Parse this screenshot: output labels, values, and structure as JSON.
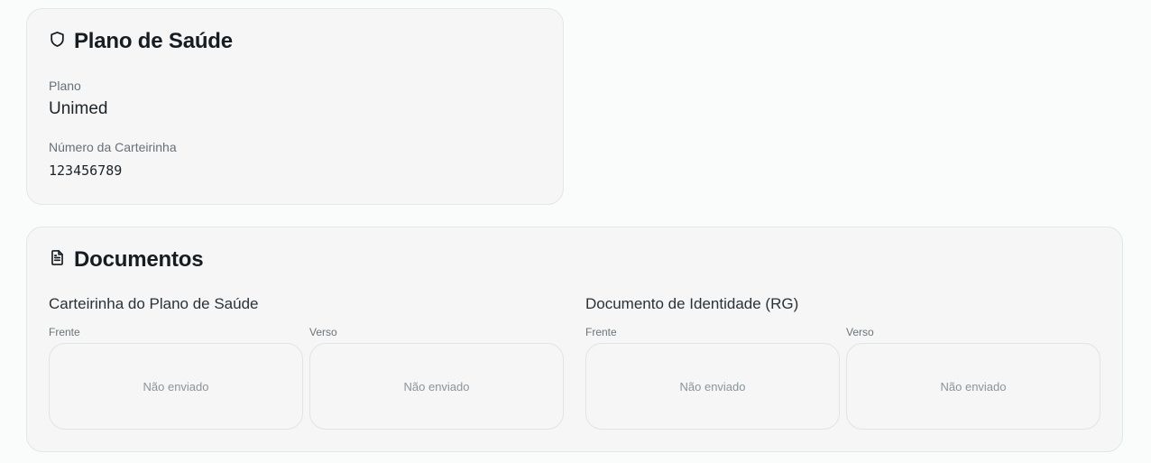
{
  "health_plan": {
    "title": "Plano de Saúde",
    "icon": "shield-icon",
    "plan_label": "Plano",
    "plan_value": "Unimed",
    "card_number_label": "Número da Carteirinha",
    "card_number_value": "123456789"
  },
  "documents": {
    "title": "Documentos",
    "icon": "document-icon",
    "groups": [
      {
        "title": "Carteirinha do Plano de Saúde",
        "front_label": "Frente",
        "front_status": "Não enviado",
        "back_label": "Verso",
        "back_status": "Não enviado"
      },
      {
        "title": "Documento de Identidade (RG)",
        "front_label": "Frente",
        "front_status": "Não enviado",
        "back_label": "Verso",
        "back_status": "Não enviado"
      }
    ]
  }
}
